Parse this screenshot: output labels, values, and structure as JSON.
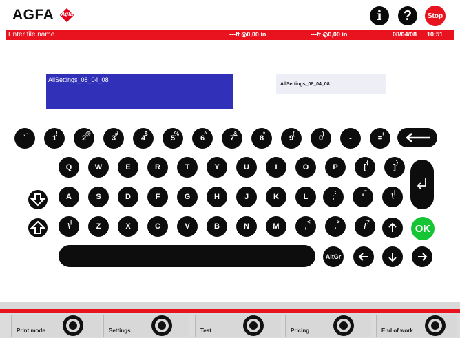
{
  "header": {
    "logo_text": "AGFA",
    "logo_badge": "Agfa",
    "info_icon": "i",
    "help_icon": "?",
    "stop_label": "Stop"
  },
  "status": {
    "title": "Enter file name",
    "counter1": "---ft ◎0,00 in",
    "counter2": "---ft ◎0,00 in",
    "date": "08/04/08",
    "time": "10:51"
  },
  "fields": {
    "filename_value": "AllSettings_08_04_08",
    "preview_value": "AllSettings_08_04_08"
  },
  "keyboard": {
    "row1": [
      {
        "main": "`",
        "shift": "~"
      },
      {
        "main": "1",
        "shift": "!"
      },
      {
        "main": "2",
        "shift": "@"
      },
      {
        "main": "3",
        "shift": "#"
      },
      {
        "main": "4",
        "shift": "$"
      },
      {
        "main": "5",
        "shift": "%"
      },
      {
        "main": "6",
        "shift": "^"
      },
      {
        "main": "7",
        "shift": "&"
      },
      {
        "main": "8",
        "shift": "*"
      },
      {
        "main": "9",
        "shift": "("
      },
      {
        "main": "0",
        "shift": ")"
      },
      {
        "main": "-",
        "shift": "_"
      },
      {
        "main": "=",
        "shift": "+"
      }
    ],
    "row2": [
      "Q",
      "W",
      "E",
      "R",
      "T",
      "Y",
      "U",
      "I",
      "O",
      "P"
    ],
    "row2_extra": [
      {
        "main": "[",
        "shift": "{"
      },
      {
        "main": "]",
        "shift": "}"
      }
    ],
    "row3": [
      "A",
      "S",
      "D",
      "F",
      "G",
      "H",
      "J",
      "K",
      "L"
    ],
    "row3_extra": [
      {
        "main": ";",
        "shift": ":"
      },
      {
        "main": "'",
        "shift": "\""
      },
      {
        "main": "\\",
        "shift": "|"
      }
    ],
    "row4_pipe": {
      "main": "\\",
      "shift": "|"
    },
    "row4": [
      "Z",
      "X",
      "C",
      "V",
      "B",
      "N",
      "M"
    ],
    "row4_extra": [
      {
        "main": ",",
        "shift": "<"
      },
      {
        "main": ".",
        "shift": ">"
      },
      {
        "main": "/",
        "shift": "?"
      }
    ],
    "altgr_label": "AltGr",
    "ok_label": "OK",
    "icons": {
      "backspace": "backspace-arrow-icon",
      "enter": "enter-return-icon",
      "caps": "caps-lock-icon",
      "shift": "shift-icon",
      "up": "arrow-up-icon",
      "down": "arrow-down-icon",
      "left": "arrow-left-icon",
      "right": "arrow-right-icon"
    }
  },
  "footer": {
    "buttons": [
      {
        "label": "Print mode"
      },
      {
        "label": "Settings"
      },
      {
        "label": "Test"
      },
      {
        "label": "Pricing"
      },
      {
        "label": "End of work"
      }
    ]
  },
  "colors": {
    "accent_red": "#e8131f",
    "field_blue": "#3130b8",
    "ok_green": "#16c534"
  }
}
